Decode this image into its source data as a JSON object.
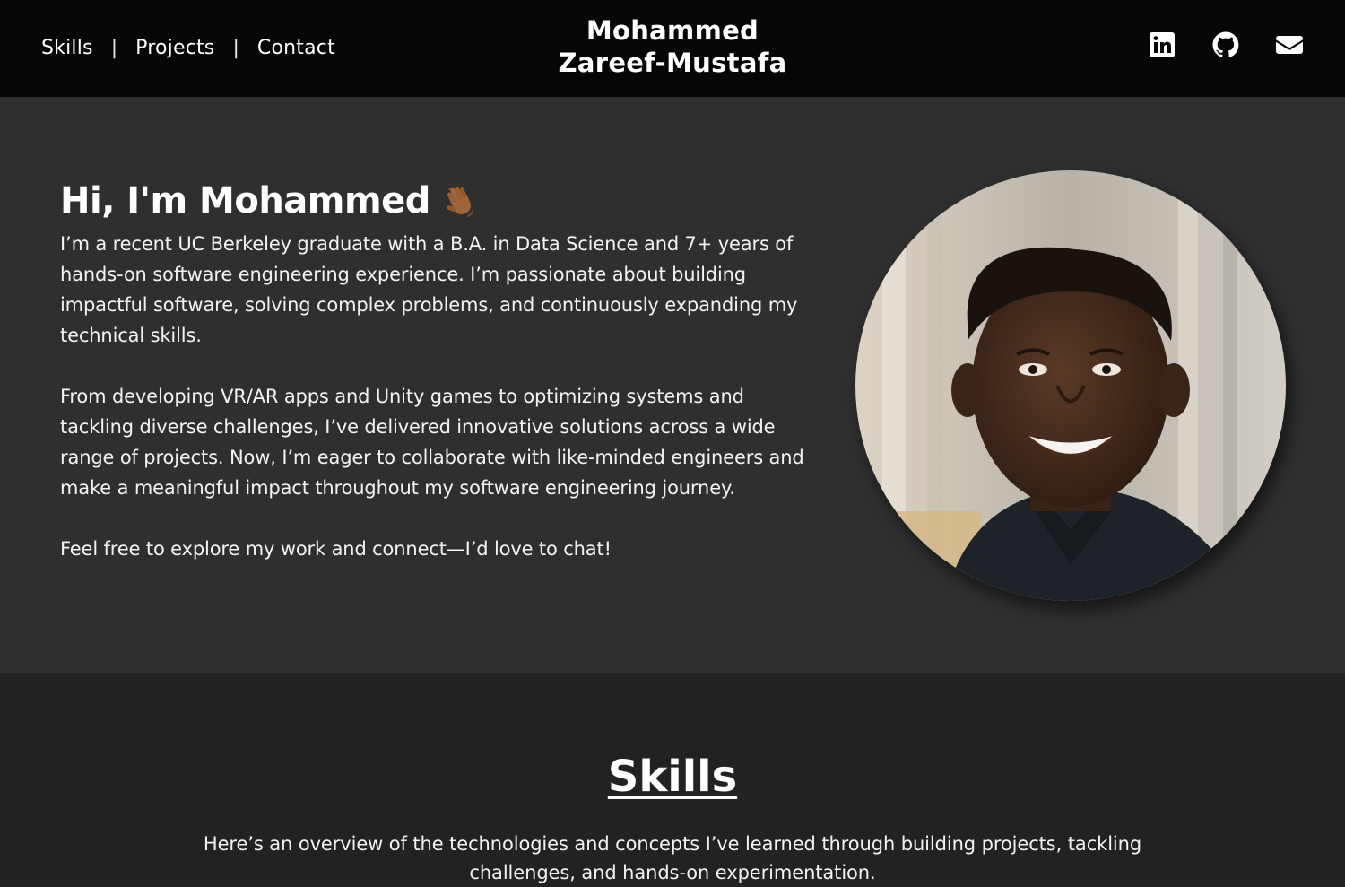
{
  "nav": {
    "items": [
      {
        "label": "Skills"
      },
      {
        "label": "Projects"
      },
      {
        "label": "Contact"
      }
    ],
    "separator": "|"
  },
  "brand": {
    "line1": "Mohammed",
    "line2": "Zareef-Mustafa"
  },
  "social": {
    "icons": [
      "linkedin-icon",
      "github-icon",
      "email-icon"
    ]
  },
  "hero": {
    "title": "Hi, I'm Mohammed",
    "wave_icon": "waving-hand-icon",
    "paragraphs": [
      "I’m a recent UC Berkeley graduate with a B.A. in Data Science and 7+ years of hands-on software engineering experience. I’m passionate about building impactful software, solving complex problems, and continuously expanding my technical skills.",
      "From developing VR/AR apps and Unity games to optimizing systems and tackling diverse challenges, I’ve delivered innovative solutions across a wide range of projects. Now, I’m eager to collaborate with like-minded engineers and make a meaningful impact throughout my software engineering journey.",
      "Feel free to explore my work and connect—I’d love to chat!"
    ]
  },
  "skills": {
    "title": "Skills",
    "intro": "Here’s an overview of the technologies and concepts I’ve learned through building projects, tackling challenges, and hands-on experimentation."
  },
  "colors": {
    "header_bg": "#060606",
    "hero_bg": "#2f2f2f",
    "skills_bg": "#222222",
    "text": "#ffffff"
  }
}
